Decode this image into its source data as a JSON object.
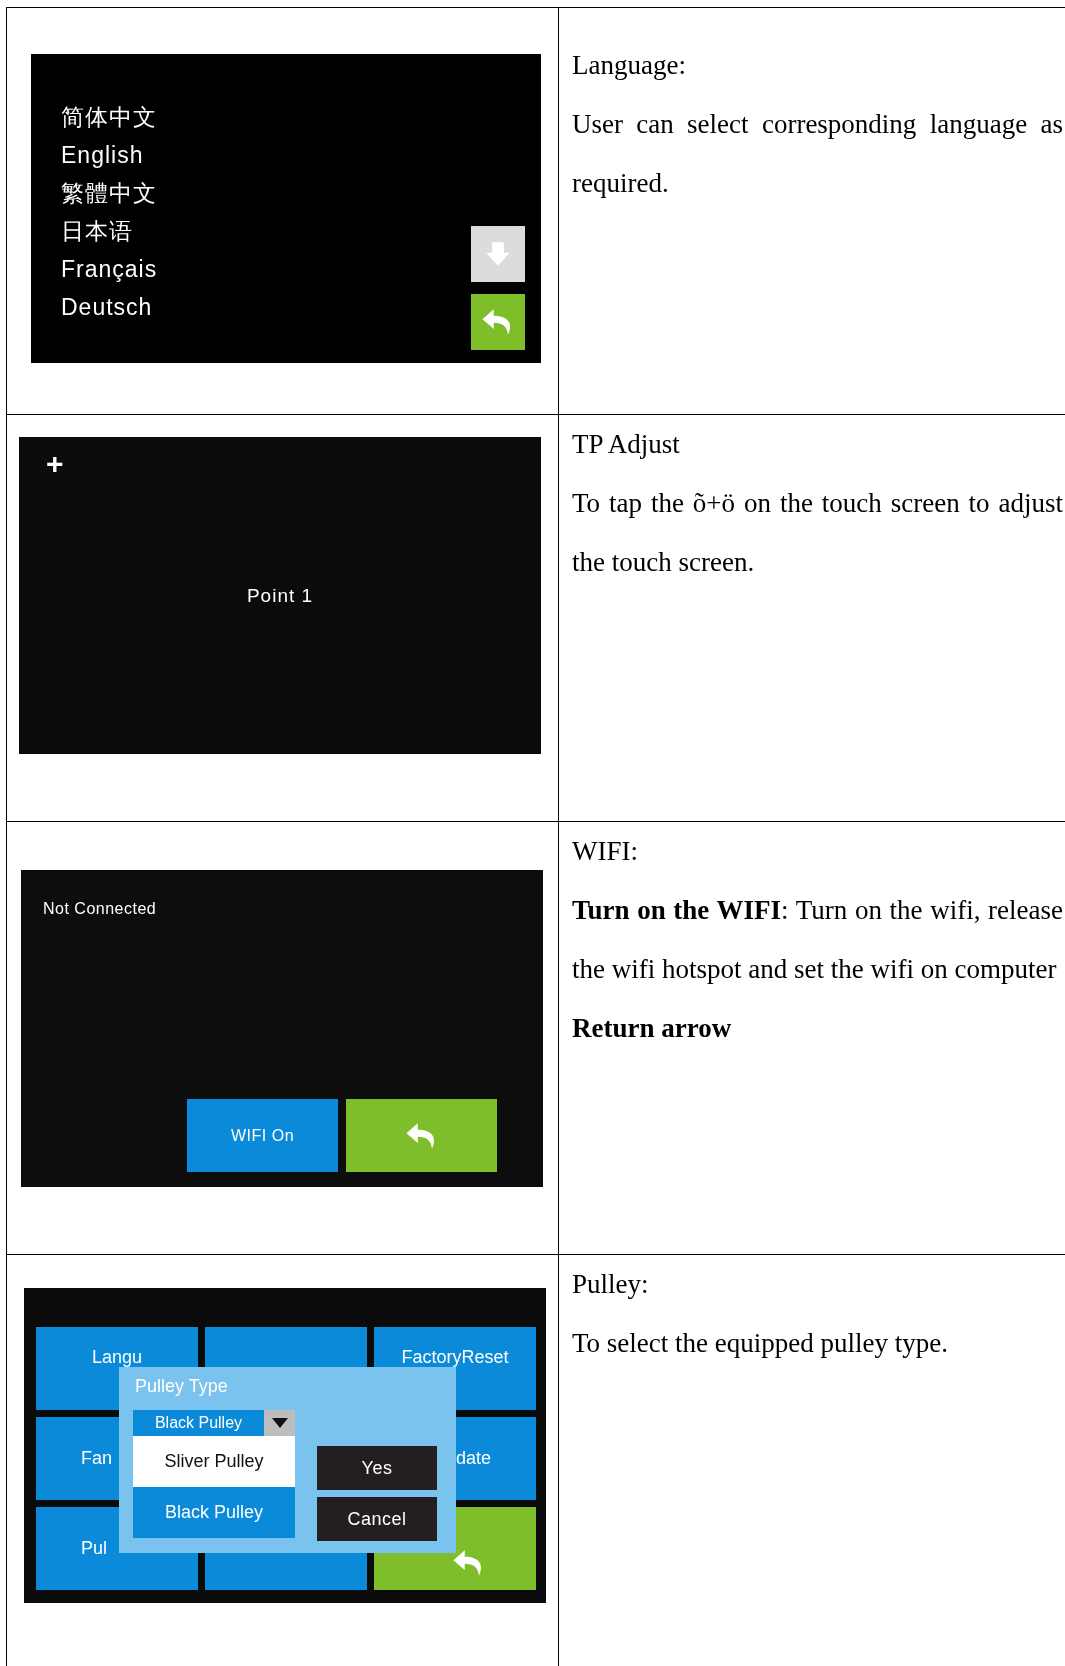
{
  "rows": [
    {
      "screen": {
        "kind": "language",
        "options": [
          "简体中文",
          "English",
          "繁體中文",
          "日本语",
          "Français",
          "Deutsch"
        ]
      },
      "description": [
        {
          "kind": "heading",
          "text": "Language:"
        },
        {
          "kind": "para",
          "text": "User can select corresponding language as required."
        }
      ]
    },
    {
      "screen": {
        "kind": "calibration",
        "cross": "+",
        "label": "Point 1"
      },
      "description": [
        {
          "kind": "heading",
          "text": "TP Adjust"
        },
        {
          "kind": "para",
          "text": "To tap the õ+ö on the touch screen to adjust the touch screen."
        }
      ]
    },
    {
      "screen": {
        "kind": "wifi",
        "status": "Not Connected",
        "button": "WIFI On"
      },
      "description": [
        {
          "kind": "heading",
          "text": "WIFI:"
        },
        {
          "kind": "para",
          "text": "**Turn on the WIFI**: Turn on the wifi, release the wifi hotspot and set the wifi on computer"
        },
        {
          "kind": "bold",
          "text": "Return arrow"
        }
      ]
    },
    {
      "screen": {
        "kind": "menu",
        "tiles": [
          {
            "kind": "text",
            "label": "Langu",
            "color": "#0a8ad8"
          },
          {
            "kind": "blank",
            "color": "#0a8ad8"
          },
          {
            "kind": "text",
            "label": "FactoryReset",
            "color": "#0a8ad8"
          },
          {
            "kind": "text",
            "label": "Fan",
            "color": "#0a8ad8"
          },
          {
            "kind": "text",
            "label": "date",
            "color": "#0a8ad8"
          },
          {
            "kind": "text",
            "label": "Pul",
            "color": "#0a8ad8"
          },
          {
            "kind": "blank",
            "color": "#0a8ad8"
          },
          {
            "kind": "back",
            "color": "#7dbe2a"
          }
        ],
        "dialog": {
          "title": "Pulley Type",
          "dropdown": "Black Pulley",
          "options": [
            {
              "label": "Sliver Pulley",
              "selected": false
            },
            {
              "label": "Black Pulley",
              "selected": true
            }
          ],
          "buttons": [
            "Yes",
            "Cancel"
          ]
        }
      },
      "description": [
        {
          "kind": "heading",
          "text": "Pulley:"
        },
        {
          "kind": "para",
          "text": "To select the equipped pulley type."
        }
      ]
    }
  ]
}
